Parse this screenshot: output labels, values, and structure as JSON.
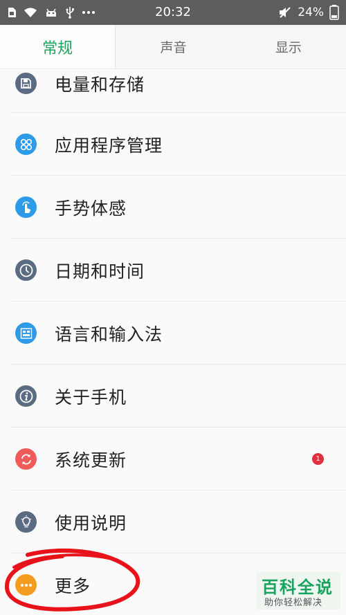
{
  "status_bar": {
    "time": "20:32",
    "battery": "24%",
    "left_icons": [
      "sim-icon",
      "wifi-icon",
      "android-icon",
      "usb-icon",
      "more-dots-icon"
    ],
    "right_icons": [
      "mute-icon",
      "battery-icon"
    ]
  },
  "tabs": [
    {
      "label": "常规",
      "active": true
    },
    {
      "label": "声音",
      "active": false
    },
    {
      "label": "显示",
      "active": false
    }
  ],
  "settings": [
    {
      "label": "电量和存储",
      "icon": "storage-icon",
      "color": "#5b6b82"
    },
    {
      "label": "应用程序管理",
      "icon": "apps-icon",
      "color": "#2e9be8"
    },
    {
      "label": "手势体感",
      "icon": "gesture-icon",
      "color": "#2e9be8"
    },
    {
      "label": "日期和时间",
      "icon": "clock-icon",
      "color": "#5b6b82"
    },
    {
      "label": "语言和输入法",
      "icon": "keyboard-icon",
      "color": "#2e9be8"
    },
    {
      "label": "关于手机",
      "icon": "info-icon",
      "color": "#5b6b82"
    },
    {
      "label": "系统更新",
      "icon": "update-icon",
      "color": "#ef5a5a",
      "badge": "1"
    },
    {
      "label": "使用说明",
      "icon": "bulb-icon",
      "color": "#5b6b82"
    },
    {
      "label": "更多",
      "icon": "more-icon",
      "color": "#f39c1f"
    }
  ],
  "watermark": {
    "title": "百科全说",
    "subtitle": "助你轻松解决"
  },
  "colors": {
    "accent": "#1aa35f",
    "status_bar": "#5d5d5d",
    "badge": "#e0303d",
    "annotation": "#e8121b"
  }
}
